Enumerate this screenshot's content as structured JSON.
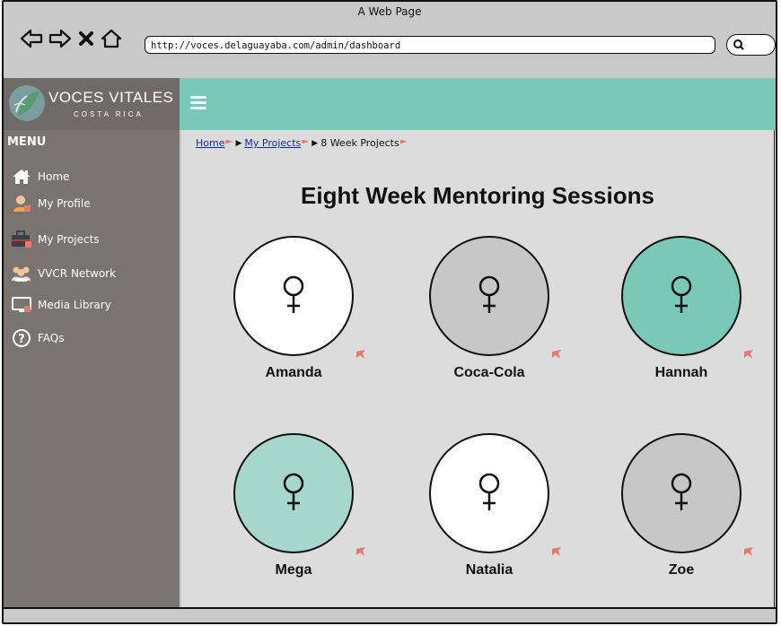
{
  "browser": {
    "title": "A Web Page",
    "url": "http://voces.delaguayaba.com/admin/dashboard"
  },
  "logo": {
    "name": "VOCES VITALES",
    "sub": "COSTA RICA"
  },
  "sidebar": {
    "menu_title": "MENU",
    "items": [
      {
        "label": "Home",
        "icon": "home-icon"
      },
      {
        "label": "My Profile",
        "icon": "user-icon"
      },
      {
        "label": "My Projects",
        "icon": "briefcase-icon"
      },
      {
        "label": "VVCR Network",
        "icon": "group-icon"
      },
      {
        "label": "Media Library",
        "icon": "monitor-icon"
      },
      {
        "label": "FAQs",
        "icon": "question-icon"
      }
    ]
  },
  "breadcrumb": {
    "home": "Home",
    "projects": "My Projects",
    "current": "8 Week Projects"
  },
  "main": {
    "title": "Eight Week Mentoring Sessions",
    "sessions": [
      {
        "name": "Amanda",
        "color": "#ffffff"
      },
      {
        "name": "Coca-Cola",
        "color": "#c7c7c7"
      },
      {
        "name": "Hannah",
        "color": "#7ac9b8"
      },
      {
        "name": "Mega",
        "color": "#a6d7cc"
      },
      {
        "name": "Natalia",
        "color": "#ffffff"
      },
      {
        "name": "Zoe",
        "color": "#c7c7c7"
      }
    ]
  },
  "colors": {
    "accent": "#7ac9b8",
    "sidebar": "#7a7470",
    "flag": "#e8786c"
  }
}
